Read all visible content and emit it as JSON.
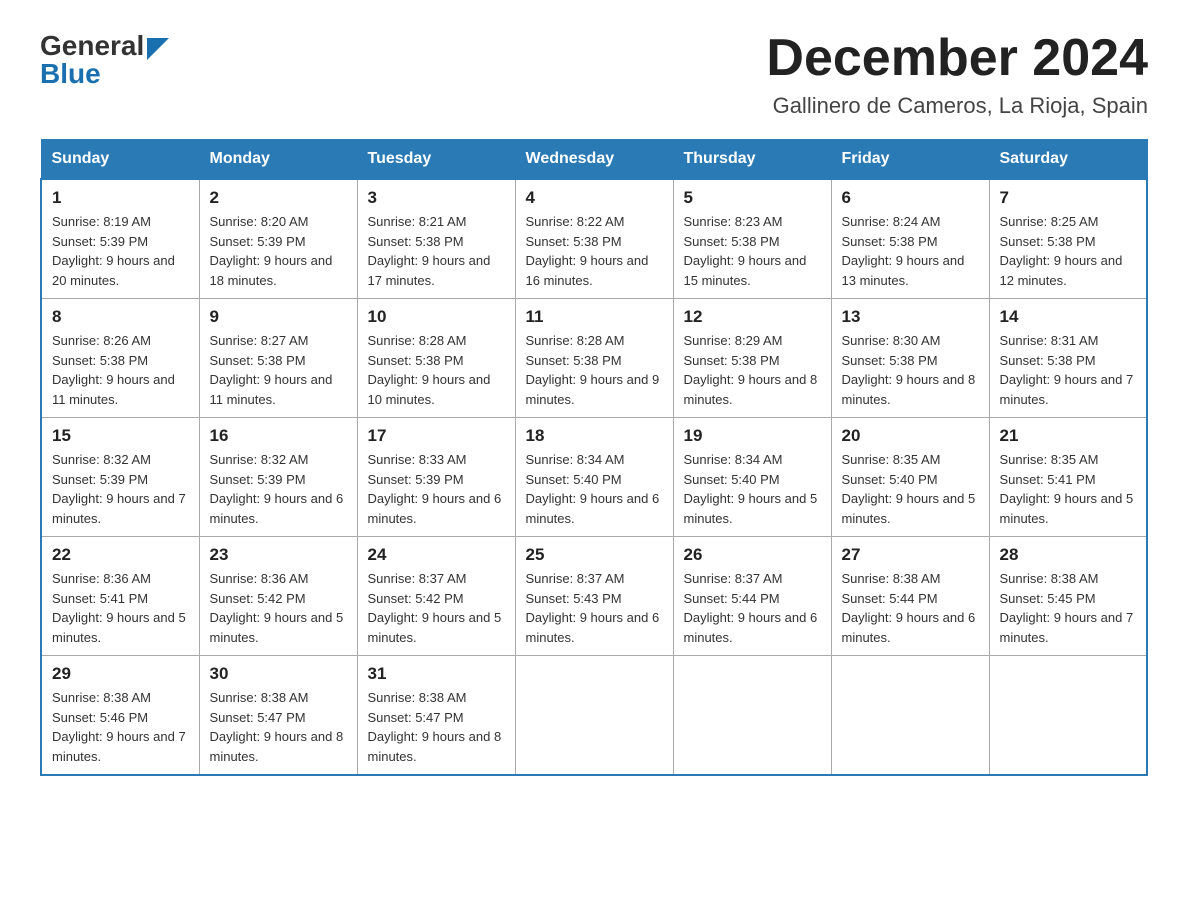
{
  "header": {
    "logo_general": "General",
    "logo_blue": "Blue",
    "month_title": "December 2024",
    "location": "Gallinero de Cameros, La Rioja, Spain"
  },
  "days_of_week": [
    "Sunday",
    "Monday",
    "Tuesday",
    "Wednesday",
    "Thursday",
    "Friday",
    "Saturday"
  ],
  "weeks": [
    [
      {
        "day": "1",
        "sunrise": "8:19 AM",
        "sunset": "5:39 PM",
        "daylight": "9 hours and 20 minutes."
      },
      {
        "day": "2",
        "sunrise": "8:20 AM",
        "sunset": "5:39 PM",
        "daylight": "9 hours and 18 minutes."
      },
      {
        "day": "3",
        "sunrise": "8:21 AM",
        "sunset": "5:38 PM",
        "daylight": "9 hours and 17 minutes."
      },
      {
        "day": "4",
        "sunrise": "8:22 AM",
        "sunset": "5:38 PM",
        "daylight": "9 hours and 16 minutes."
      },
      {
        "day": "5",
        "sunrise": "8:23 AM",
        "sunset": "5:38 PM",
        "daylight": "9 hours and 15 minutes."
      },
      {
        "day": "6",
        "sunrise": "8:24 AM",
        "sunset": "5:38 PM",
        "daylight": "9 hours and 13 minutes."
      },
      {
        "day": "7",
        "sunrise": "8:25 AM",
        "sunset": "5:38 PM",
        "daylight": "9 hours and 12 minutes."
      }
    ],
    [
      {
        "day": "8",
        "sunrise": "8:26 AM",
        "sunset": "5:38 PM",
        "daylight": "9 hours and 11 minutes."
      },
      {
        "day": "9",
        "sunrise": "8:27 AM",
        "sunset": "5:38 PM",
        "daylight": "9 hours and 11 minutes."
      },
      {
        "day": "10",
        "sunrise": "8:28 AM",
        "sunset": "5:38 PM",
        "daylight": "9 hours and 10 minutes."
      },
      {
        "day": "11",
        "sunrise": "8:28 AM",
        "sunset": "5:38 PM",
        "daylight": "9 hours and 9 minutes."
      },
      {
        "day": "12",
        "sunrise": "8:29 AM",
        "sunset": "5:38 PM",
        "daylight": "9 hours and 8 minutes."
      },
      {
        "day": "13",
        "sunrise": "8:30 AM",
        "sunset": "5:38 PM",
        "daylight": "9 hours and 8 minutes."
      },
      {
        "day": "14",
        "sunrise": "8:31 AM",
        "sunset": "5:38 PM",
        "daylight": "9 hours and 7 minutes."
      }
    ],
    [
      {
        "day": "15",
        "sunrise": "8:32 AM",
        "sunset": "5:39 PM",
        "daylight": "9 hours and 7 minutes."
      },
      {
        "day": "16",
        "sunrise": "8:32 AM",
        "sunset": "5:39 PM",
        "daylight": "9 hours and 6 minutes."
      },
      {
        "day": "17",
        "sunrise": "8:33 AM",
        "sunset": "5:39 PM",
        "daylight": "9 hours and 6 minutes."
      },
      {
        "day": "18",
        "sunrise": "8:34 AM",
        "sunset": "5:40 PM",
        "daylight": "9 hours and 6 minutes."
      },
      {
        "day": "19",
        "sunrise": "8:34 AM",
        "sunset": "5:40 PM",
        "daylight": "9 hours and 5 minutes."
      },
      {
        "day": "20",
        "sunrise": "8:35 AM",
        "sunset": "5:40 PM",
        "daylight": "9 hours and 5 minutes."
      },
      {
        "day": "21",
        "sunrise": "8:35 AM",
        "sunset": "5:41 PM",
        "daylight": "9 hours and 5 minutes."
      }
    ],
    [
      {
        "day": "22",
        "sunrise": "8:36 AM",
        "sunset": "5:41 PM",
        "daylight": "9 hours and 5 minutes."
      },
      {
        "day": "23",
        "sunrise": "8:36 AM",
        "sunset": "5:42 PM",
        "daylight": "9 hours and 5 minutes."
      },
      {
        "day": "24",
        "sunrise": "8:37 AM",
        "sunset": "5:42 PM",
        "daylight": "9 hours and 5 minutes."
      },
      {
        "day": "25",
        "sunrise": "8:37 AM",
        "sunset": "5:43 PM",
        "daylight": "9 hours and 6 minutes."
      },
      {
        "day": "26",
        "sunrise": "8:37 AM",
        "sunset": "5:44 PM",
        "daylight": "9 hours and 6 minutes."
      },
      {
        "day": "27",
        "sunrise": "8:38 AM",
        "sunset": "5:44 PM",
        "daylight": "9 hours and 6 minutes."
      },
      {
        "day": "28",
        "sunrise": "8:38 AM",
        "sunset": "5:45 PM",
        "daylight": "9 hours and 7 minutes."
      }
    ],
    [
      {
        "day": "29",
        "sunrise": "8:38 AM",
        "sunset": "5:46 PM",
        "daylight": "9 hours and 7 minutes."
      },
      {
        "day": "30",
        "sunrise": "8:38 AM",
        "sunset": "5:47 PM",
        "daylight": "9 hours and 8 minutes."
      },
      {
        "day": "31",
        "sunrise": "8:38 AM",
        "sunset": "5:47 PM",
        "daylight": "9 hours and 8 minutes."
      },
      null,
      null,
      null,
      null
    ]
  ]
}
